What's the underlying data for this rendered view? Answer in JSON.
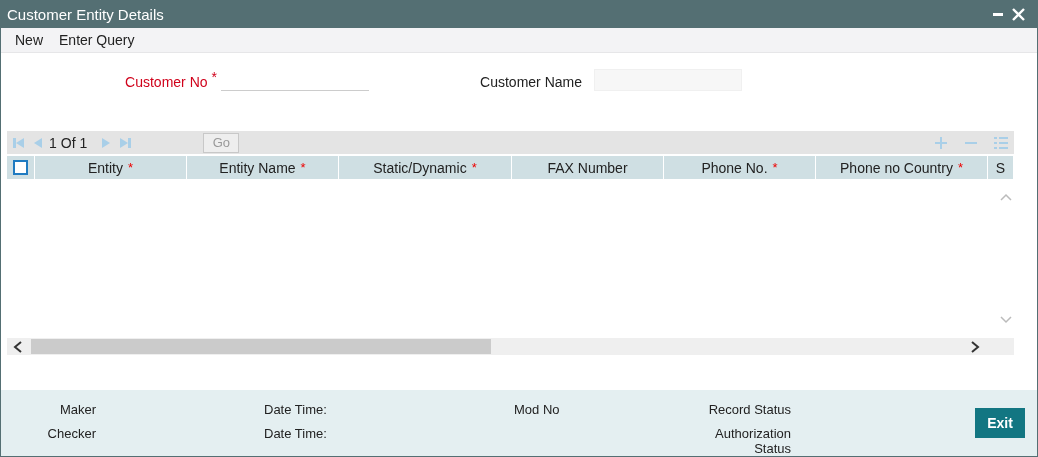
{
  "window": {
    "title": "Customer Entity Details"
  },
  "menu": [
    "New",
    "Enter Query"
  ],
  "fields": [
    {
      "label": "Customer No",
      "mark": "*"
    },
    {
      "label": "Customer Name"
    }
  ],
  "pager": {
    "current": "1",
    "of": "Of",
    "total": "1",
    "go": "Go"
  },
  "table": {
    "select_all": {
      "checked": false
    },
    "columns": [
      {
        "label": "Entity",
        "mark": "*"
      },
      {
        "label": "Entity Name",
        "mark": "*"
      },
      {
        "label": "Static/Dynamic",
        "mark": "*"
      },
      {
        "label": "FAX Number"
      },
      {
        "label": "Phone No.",
        "mark": "*"
      },
      {
        "label": "Phone no Country",
        "mark": "*"
      },
      {
        "label": "S"
      }
    ]
  },
  "audit": [
    {
      "kind": "right",
      "labels": [
        "Maker",
        "Checker"
      ]
    },
    {
      "kind": "left",
      "labels": [
        "Date Time:",
        "Date Time:"
      ]
    },
    {
      "kind": "left",
      "labels": [
        "Mod No"
      ]
    },
    {
      "kind": "right",
      "labels": [
        "Record Status",
        "Authorization Status"
      ]
    }
  ],
  "exit": "Exit"
}
